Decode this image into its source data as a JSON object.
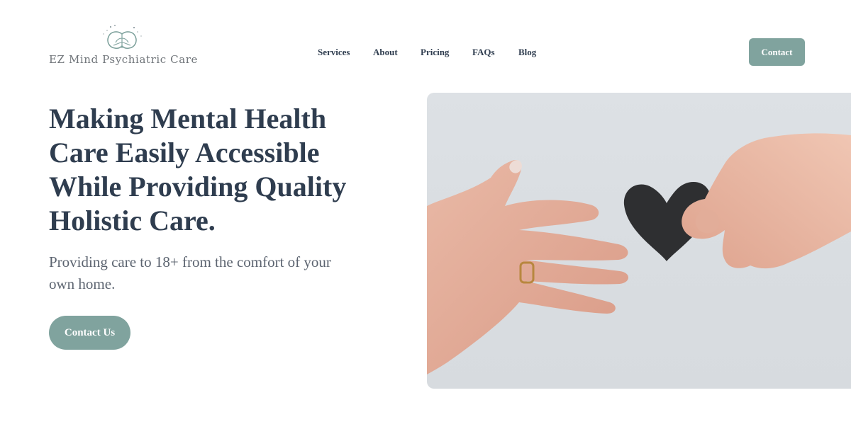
{
  "brand": {
    "name": "EZ Mind Psychiatric Care",
    "logo_icon": "brain-icon",
    "accent_color": "#80a39e",
    "text_color": "#2f3d4f"
  },
  "nav": {
    "items": [
      {
        "label": "Services"
      },
      {
        "label": "About"
      },
      {
        "label": "Pricing"
      },
      {
        "label": "FAQs"
      },
      {
        "label": "Blog"
      }
    ],
    "contact_label": "Contact"
  },
  "hero": {
    "title": "Making Mental Health Care Easily Accessible While Providing Quality Holistic Care.",
    "subtitle": "Providing care to 18+ from the comfort of your own home.",
    "cta_label": "Contact Us",
    "image_icon": "hands-heart-photo"
  }
}
